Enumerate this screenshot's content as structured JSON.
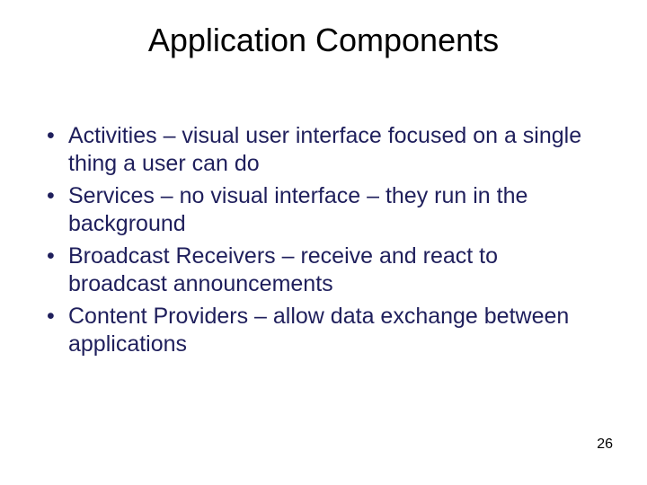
{
  "title": "Application Components",
  "bullets": [
    "Activities – visual user interface focused on a single thing a user can do",
    "Services – no visual interface – they run in the background",
    "Broadcast Receivers – receive and react to broadcast announcements",
    "Content Providers – allow data exchange between applications"
  ],
  "page_number": "26"
}
